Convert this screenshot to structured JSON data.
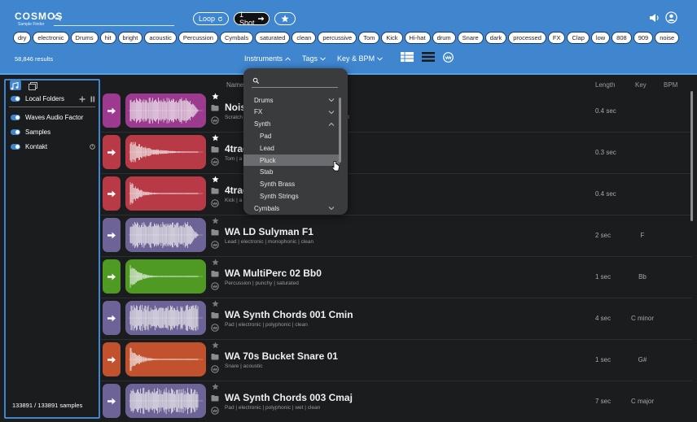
{
  "app": {
    "logo_title": "COSMOS",
    "logo_subtitle": "Sample Finder"
  },
  "search": {
    "placeholder": "",
    "value": ""
  },
  "top_buttons": {
    "loop_label": "Loop",
    "one_shot_label": "1 Shot"
  },
  "tags": [
    "dry",
    "electronic",
    "Drums",
    "hit",
    "bright",
    "acoustic",
    "Percussion",
    "Cymbals",
    "saturated",
    "clean",
    "percussive",
    "Tom",
    "Kick",
    "Hi-hat",
    "drum",
    "Snare",
    "dark",
    "processed",
    "FX",
    "Clap",
    "low",
    "808",
    "909",
    "noise"
  ],
  "results_count": "58,846 results",
  "filters": {
    "instruments": "Instruments",
    "tags": "Tags",
    "key_bpm": "Key & BPM"
  },
  "sidebar": {
    "local_folders": "Local Folders",
    "items": [
      "Waves Audio Factor",
      "Samples",
      "Kontakt"
    ],
    "count": "133891 / 133891 samples"
  },
  "columns": {
    "name": "Name",
    "length": "Length",
    "key": "Key",
    "bpm": "BPM"
  },
  "rows": [
    {
      "name": "Nois",
      "tags": "Scratch",
      "tail": "ght",
      "length": "0.4 sec",
      "key": "",
      "color": "#9b3a8e",
      "starred": true
    },
    {
      "name": "4trac",
      "tags": "Tom | a",
      "tail": "",
      "length": "0.3 sec",
      "key": "",
      "color": "#b83a46",
      "starred": true
    },
    {
      "name": "4trac",
      "tags": "Kick | a",
      "tail": "",
      "length": "0.4 sec",
      "key": "",
      "color": "#b83a46",
      "starred": true
    },
    {
      "name": "WA LD Sulyman F1",
      "tags": "Lead | electronic | monophonic | clean",
      "tail": "",
      "length": "2 sec",
      "key": "F",
      "color": "#6e6396",
      "starred": false
    },
    {
      "name": "WA MultiPerc 02 Bb0",
      "tags": "Percussion | punchy | saturated",
      "tail": "",
      "length": "1 sec",
      "key": "Bb",
      "color": "#4e9a22",
      "starred": false
    },
    {
      "name": "WA Synth Chords 001 Cmin",
      "tags": "Pad | electronic | polyphonic | clean",
      "tail": "",
      "length": "4 sec",
      "key": "C minor",
      "color": "#6e6396",
      "starred": false
    },
    {
      "name": "WA 70s Bucket Snare 01",
      "tags": "Snare | acoustic",
      "tail": "",
      "length": "1 sec",
      "key": "G#",
      "color": "#c2522e",
      "starred": false
    },
    {
      "name": "WA Synth Chords 003 Cmaj",
      "tags": "Pad | electronic | polyphonic | wet | clean",
      "tail": "",
      "length": "7 sec",
      "key": "C major",
      "color": "#6e6396",
      "starred": false
    }
  ],
  "dropdown": {
    "items": [
      {
        "label": "Drums",
        "type": "cat",
        "chev": "down"
      },
      {
        "label": "FX",
        "type": "cat",
        "chev": "down"
      },
      {
        "label": "Synth",
        "type": "cat",
        "chev": "up"
      },
      {
        "label": "Pad",
        "type": "sub"
      },
      {
        "label": "Lead",
        "type": "sub"
      },
      {
        "label": "Pluck",
        "type": "sub",
        "highlight": true
      },
      {
        "label": "Stab",
        "type": "sub"
      },
      {
        "label": "Synth Brass",
        "type": "sub"
      },
      {
        "label": "Synth Strings",
        "type": "sub"
      },
      {
        "label": "Cymbals",
        "type": "cat",
        "chev": "down"
      }
    ]
  }
}
